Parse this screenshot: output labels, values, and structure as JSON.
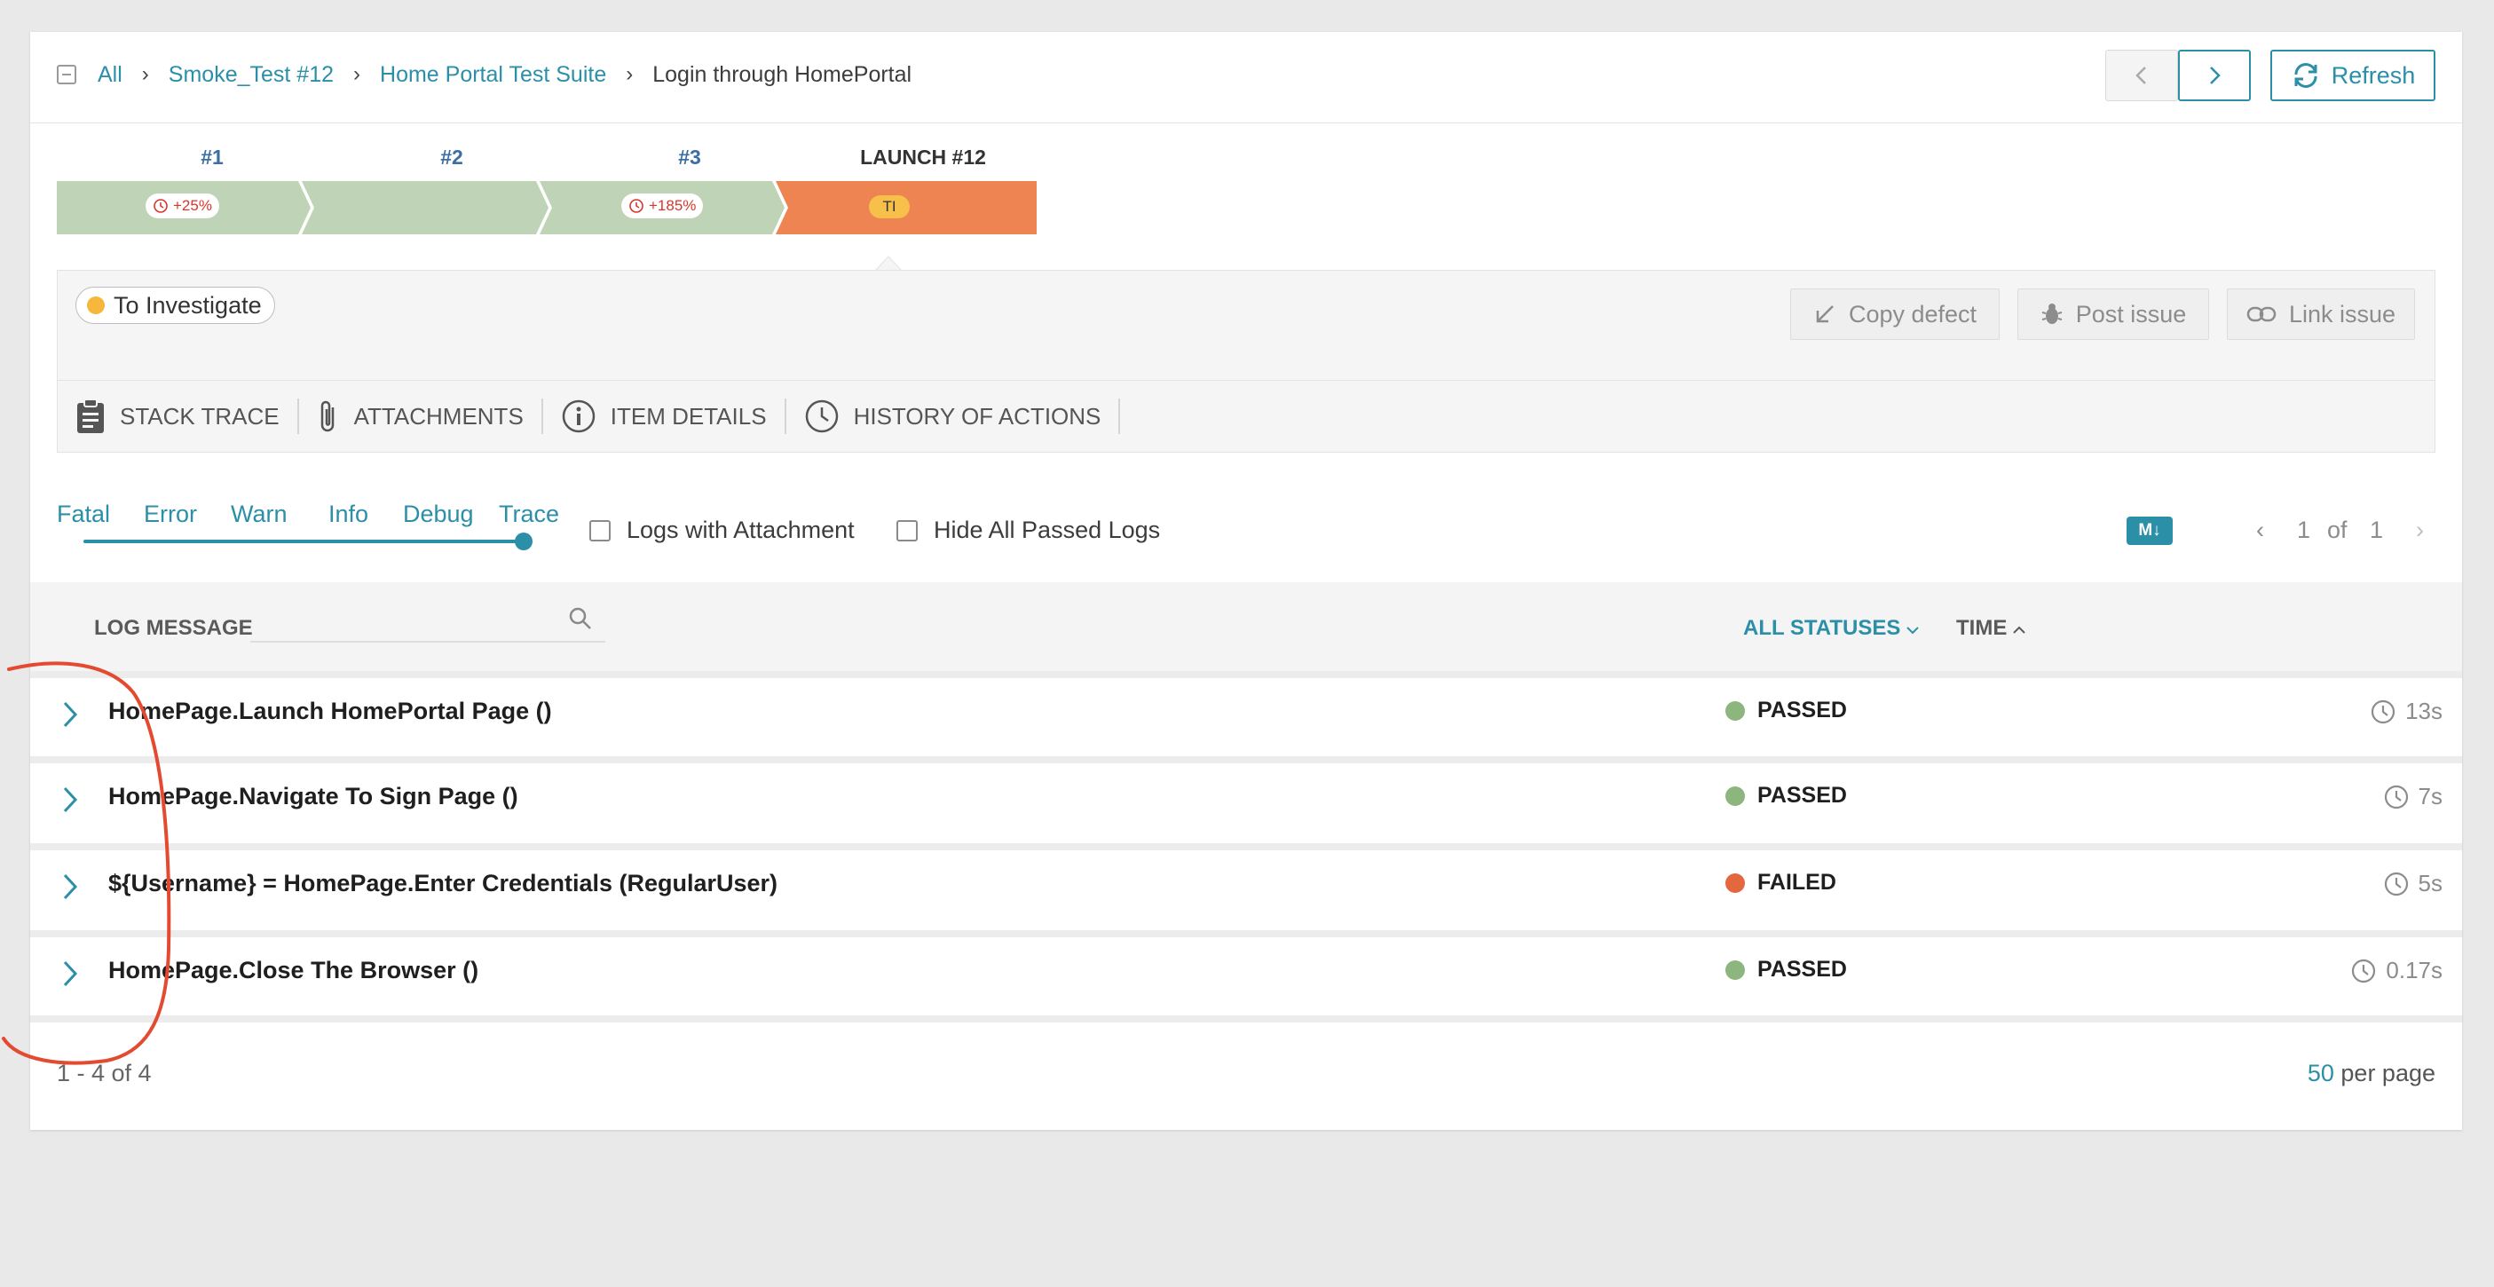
{
  "breadcrumb": {
    "items": [
      "All",
      "Smoke_Test #12",
      "Home Portal Test Suite"
    ],
    "current": "Login through HomePortal"
  },
  "toolbar": {
    "prev_icon": "chevron-left-icon",
    "next_icon": "chevron-right-icon",
    "refresh_label": "Refresh"
  },
  "history": [
    {
      "label": "#1",
      "delta": "+25%",
      "status_color": "#bfd3b6"
    },
    {
      "label": "#2",
      "delta": "",
      "status_color": "#bfd3b6"
    },
    {
      "label": "#3",
      "delta": "+185%",
      "status_color": "#bfd3b6"
    },
    {
      "label": "LAUNCH #12",
      "badge": "TI",
      "status_color": "#ef8453"
    }
  ],
  "defect": {
    "type_label": "To Investigate",
    "type_color": "#f6b73c",
    "actions": [
      "Copy defect",
      "Post issue",
      "Link issue"
    ]
  },
  "tabs": [
    "STACK TRACE",
    "ATTACHMENTS",
    "ITEM DETAILS",
    "HISTORY OF ACTIONS"
  ],
  "log_levels": [
    "Fatal",
    "Error",
    "Warn",
    "Info",
    "Debug",
    "Trace"
  ],
  "filters": {
    "logs_with_attachment": "Logs with Attachment",
    "hide_passed": "Hide All Passed Logs",
    "markdown_badge": "M↓"
  },
  "pager": {
    "current": "1",
    "of": "of",
    "total": "1"
  },
  "table": {
    "col_message": "LOG MESSAGE",
    "col_status": "ALL STATUSES",
    "col_time": "TIME",
    "rows": [
      {
        "message": "HomePage.Launch HomePortal Page ()",
        "status": "PASSED",
        "status_color": "#8db67e",
        "time": "13s"
      },
      {
        "message": "HomePage.Navigate To Sign Page ()",
        "status": "PASSED",
        "status_color": "#8db67e",
        "time": "7s"
      },
      {
        "message": "${Username} = HomePage.Enter Credentials (RegularUser)",
        "status": "FAILED",
        "status_color": "#e4683f",
        "time": "5s"
      },
      {
        "message": "HomePage.Close The Browser ()",
        "status": "PASSED",
        "status_color": "#8db67e",
        "time": "0.17s"
      }
    ]
  },
  "footer": {
    "count": "1 - 4 of 4",
    "per_page_num": "50",
    "per_page_label": "per page"
  },
  "colors": {
    "accent": "#2b8fa8",
    "annotation": "#e34a2f"
  }
}
